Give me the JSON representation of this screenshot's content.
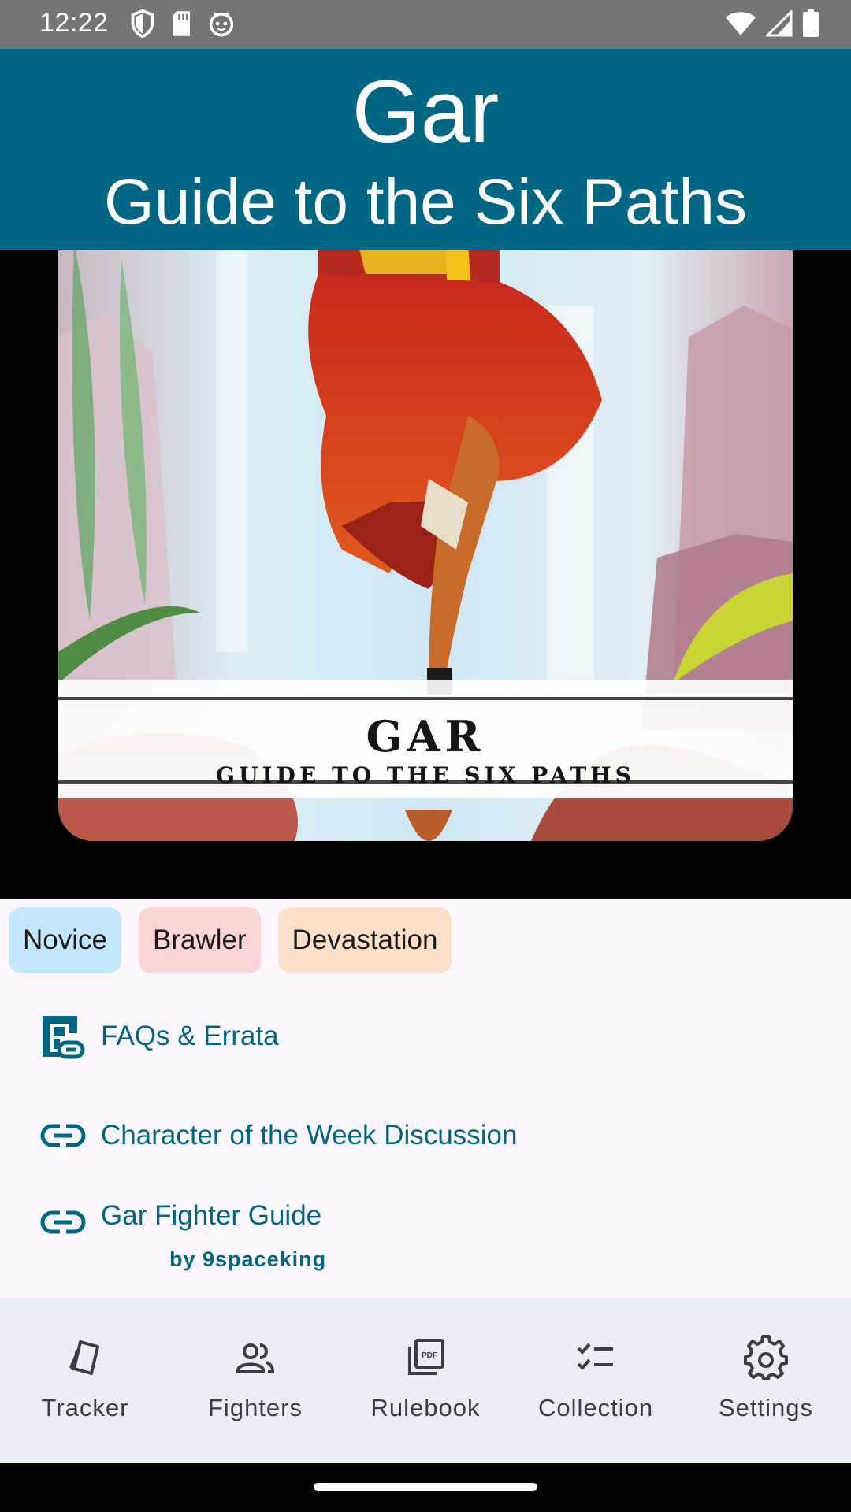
{
  "status_bar": {
    "time": "12:22",
    "left_icons": [
      "shield-icon",
      "sd-card-icon",
      "cat-face-icon"
    ],
    "right_icons": [
      "wifi-icon",
      "signal-icon",
      "battery-icon"
    ]
  },
  "header": {
    "fighter_name": "Gar",
    "box_title": "Guide to the Six Paths",
    "background_color": "#016683"
  },
  "card_art": {
    "card_name": "Gar",
    "card_subtitle": "Guide to the Six Paths"
  },
  "tags": [
    {
      "label": "Novice",
      "color": "#c3e8fb"
    },
    {
      "label": "Brawler",
      "color": "#fbd5d5"
    },
    {
      "label": "Devastation",
      "color": "#fde0c8"
    }
  ],
  "links": [
    {
      "label": "FAQs & Errata",
      "icon": "faq-link-icon"
    },
    {
      "label": "Character of the Week Discussion",
      "icon": "link-icon"
    },
    {
      "label": "Gar Fighter Guide",
      "icon": "link-icon",
      "author": "by 9spaceking"
    }
  ],
  "bottom_nav": [
    {
      "label": "Tracker",
      "icon": "cards-icon"
    },
    {
      "label": "Fighters",
      "icon": "people-icon"
    },
    {
      "label": "Rulebook",
      "icon": "pdf-icon"
    },
    {
      "label": "Collection",
      "icon": "checklist-icon"
    },
    {
      "label": "Settings",
      "icon": "gear-icon"
    }
  ]
}
